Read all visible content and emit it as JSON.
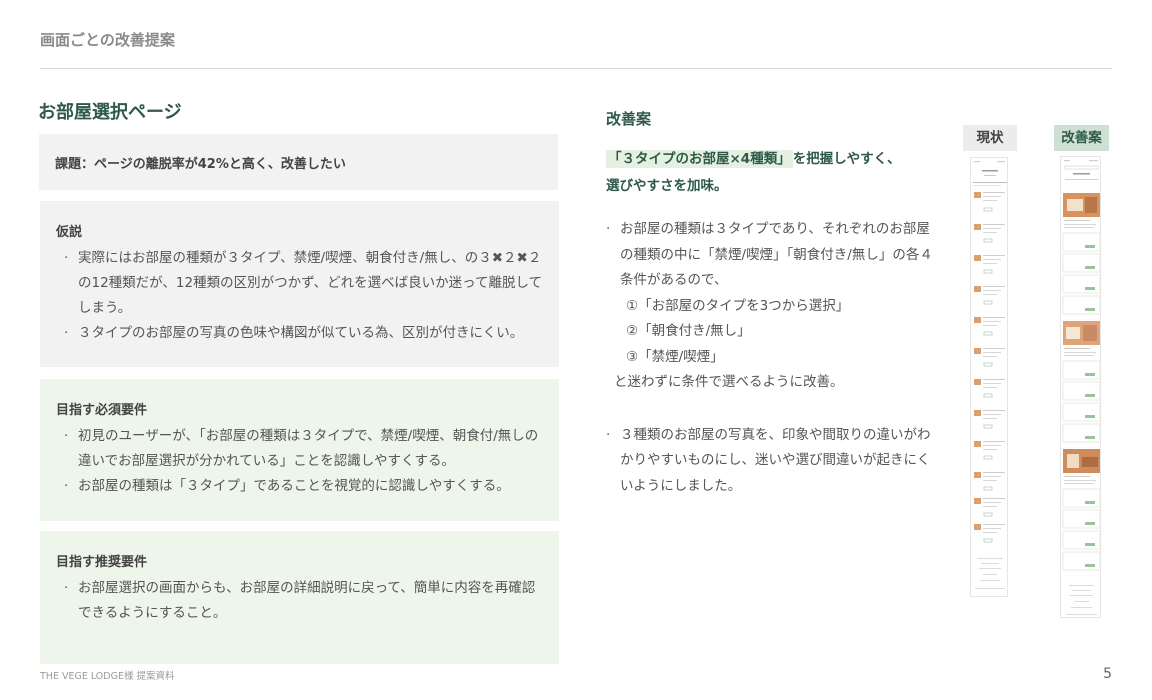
{
  "header": {
    "title": "画面ごとの改善提案"
  },
  "left": {
    "title": "お部屋選択ページ",
    "issue": "課題：ページの離脱率が42%と高く、改善したい",
    "hypothesis": {
      "title": "仮説",
      "items": [
        "実際にはお部屋の種類が３タイプ、禁煙/喫煙、朝食付き/無し、の３✖︎２✖︎２の12種類だが、12種類の区別がつかず、どれを選べば良いか迷って離脱してしまう。",
        "３タイプのお部屋の写真の色味や構図が似ている為、区別が付きにくい。"
      ]
    },
    "required": {
      "title": "目指す必須要件",
      "items": [
        "初見のユーザーが、「お部屋の種類は３タイプで、禁煙/喫煙、朝食付/無しの違いでお部屋選択が分かれている」ことを認識しやすくする。",
        "お部屋の種類は「３タイプ」であることを視覚的に認識しやすくする。"
      ]
    },
    "recommended": {
      "title": "目指す推奨要件",
      "items": [
        "お部屋選択の画面からも、お部屋の詳細説明に戻って、簡単に内容を再確認できるようにすること。"
      ]
    }
  },
  "right": {
    "title": "改善案",
    "headline_highlight": "「３タイプのお部屋×4種類」",
    "headline_rest1": "を把握しやすく、",
    "headline_rest2": "選びやすさを加味。",
    "item1": {
      "intro": "お部屋の種類は３タイプであり、それぞれのお部屋の種類の中に「禁煙/喫煙」「朝食付き/無し」の各４条件があるので、",
      "sub1": "①「お部屋のタイプを3つから選択」",
      "sub2": "②「朝食付き/無し」",
      "sub3": "③「禁煙/喫煙」",
      "end": "と迷わずに条件で選べるように改善。"
    },
    "item2": "３種類のお部屋の写真を、印象や間取りの違いがわかりやすいものにし、迷いや選び間違いが起きにくいようにしました。",
    "label_current": "現状",
    "label_proposal": "改善案"
  },
  "footer": {
    "left": "THE VEGE LODGE様 提案資料",
    "page": "5"
  }
}
